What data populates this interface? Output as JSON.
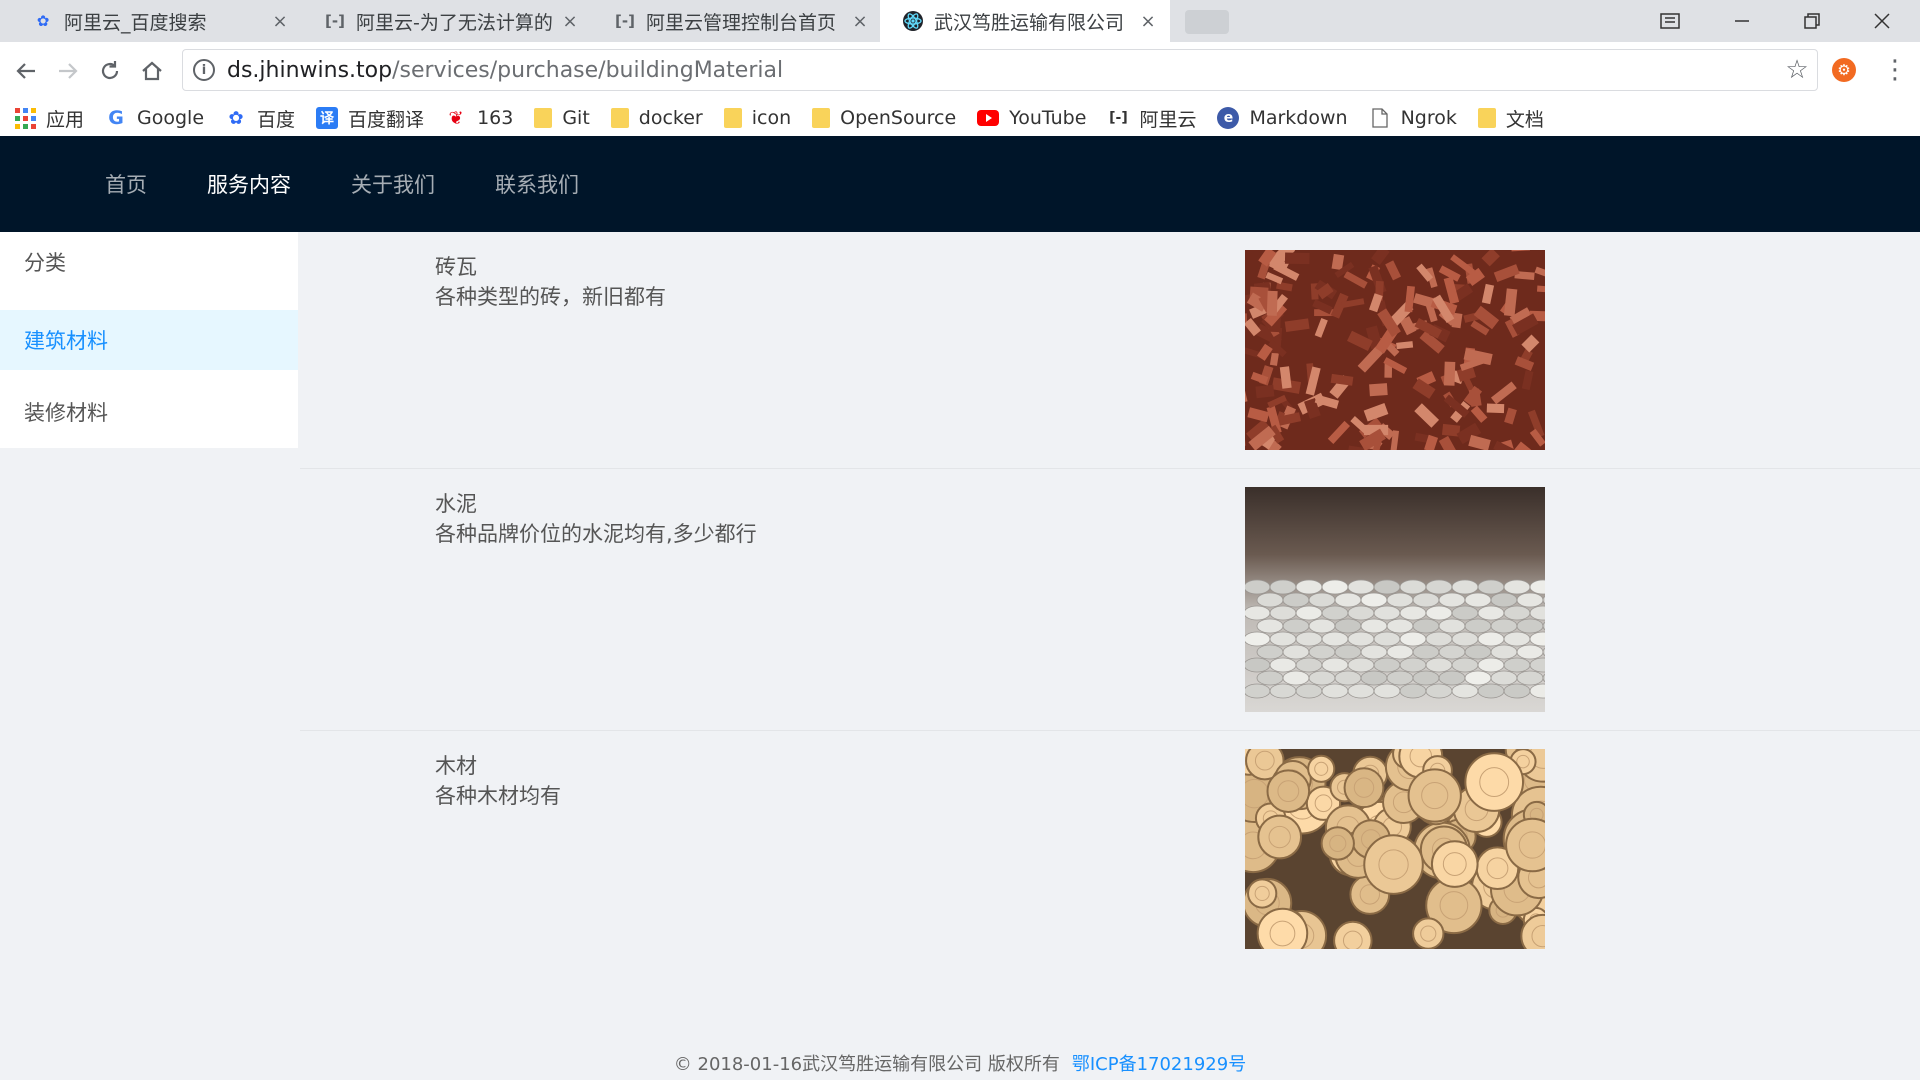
{
  "browser": {
    "tabs": [
      {
        "title": "阿里云_百度搜索",
        "icon": "baidu-paw-icon"
      },
      {
        "title": "阿里云-为了无法计算的价值",
        "icon": "aliyun-icon"
      },
      {
        "title": "阿里云管理控制台首页",
        "icon": "aliyun-icon"
      },
      {
        "title": "武汉笃胜运输有限公司",
        "icon": "react-atom-icon"
      }
    ],
    "active_tab": 3,
    "close_glyph": "×",
    "url_host": "ds.jhinwins.top",
    "url_path": "/services/purchase/buildingMaterial",
    "bookmarks": [
      {
        "label": "应用",
        "icon": "apps-grid-icon"
      },
      {
        "label": "Google",
        "icon": "google-icon"
      },
      {
        "label": "百度",
        "icon": "baidu-paw-icon"
      },
      {
        "label": "百度翻译",
        "icon": "baidu-translate-icon",
        "glyph": "译"
      },
      {
        "label": "163",
        "icon": "netease-163-icon"
      },
      {
        "label": "Git",
        "icon": "folder-icon"
      },
      {
        "label": "docker",
        "icon": "folder-icon"
      },
      {
        "label": "icon",
        "icon": "folder-icon"
      },
      {
        "label": "OpenSource",
        "icon": "folder-icon"
      },
      {
        "label": "YouTube",
        "icon": "youtube-icon"
      },
      {
        "label": "阿里云",
        "icon": "aliyun-icon"
      },
      {
        "label": "Markdown",
        "icon": "markdown-icon"
      },
      {
        "label": "Ngrok",
        "icon": "page-icon"
      },
      {
        "label": "文档",
        "icon": "folder-icon"
      }
    ]
  },
  "site": {
    "nav": [
      {
        "label": "首页"
      },
      {
        "label": "服务内容"
      },
      {
        "label": "关于我们"
      },
      {
        "label": "联系我们"
      }
    ],
    "active_nav": 1,
    "sidebar": [
      {
        "label": "分类"
      },
      {
        "label": "建筑材料"
      },
      {
        "label": "装修材料"
      }
    ],
    "selected_sidebar": 1,
    "materials": [
      {
        "title": "砖瓦",
        "desc": "各种类型的砖，新旧都有",
        "image": "bricks-photo"
      },
      {
        "title": "水泥",
        "desc": "各种品牌价位的水泥均有,多少都行",
        "image": "cement-bags-photo"
      },
      {
        "title": "木材",
        "desc": "各种木材均有",
        "image": "timber-logs-photo"
      }
    ],
    "footer": {
      "copyright": "© 2018-01-16武汉笃胜运输有限公司 版权所有",
      "icp": "鄂ICP备17021929号"
    }
  },
  "colors": {
    "header_bg": "#001529",
    "accent": "#1890ff",
    "selected_bg": "#e6f7ff",
    "page_bg": "#f0f2f5"
  }
}
